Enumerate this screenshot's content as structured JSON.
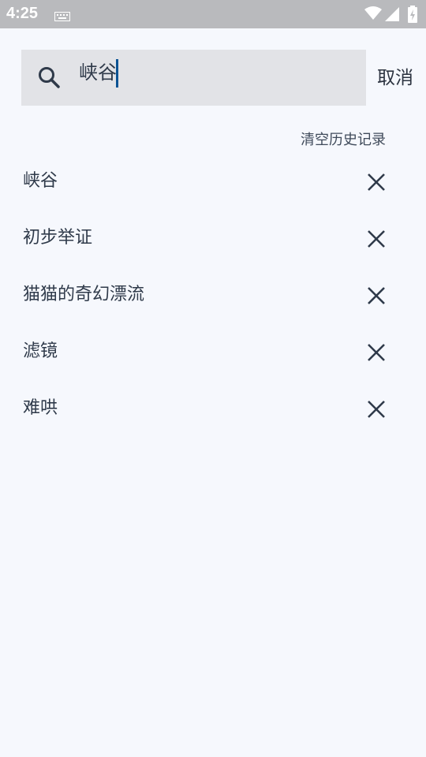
{
  "status_bar": {
    "time": "4:25",
    "icons": [
      "keyboard-icon",
      "wifi-icon",
      "signal-icon",
      "battery-icon"
    ]
  },
  "search": {
    "query": "峡谷",
    "icon": "search-icon",
    "cancel_label": "取消"
  },
  "history": {
    "clear_label": "清空历史记录",
    "items": [
      {
        "label": "峡谷"
      },
      {
        "label": "初步举证"
      },
      {
        "label": "猫猫的奇幻漂流"
      },
      {
        "label": "滤镜"
      },
      {
        "label": "难哄"
      }
    ]
  },
  "colors": {
    "background": "#f6f8fd",
    "status_bar": "#b9babd",
    "search_box": "#e2e3e7",
    "caret": "#0b5394",
    "text": "#2f3a4a"
  }
}
